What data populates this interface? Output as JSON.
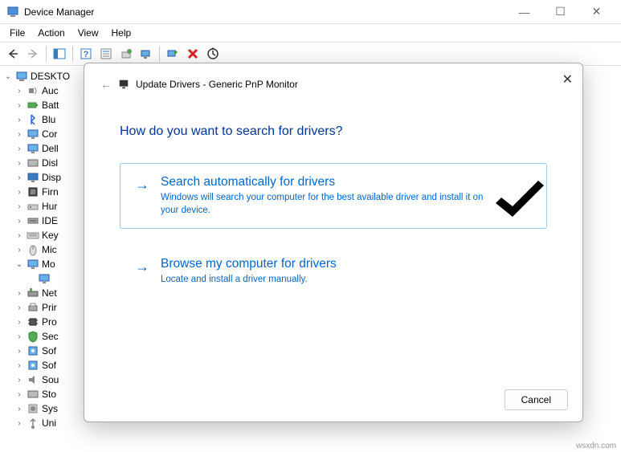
{
  "titlebar": {
    "title": "Device Manager"
  },
  "menu": {
    "file": "File",
    "action": "Action",
    "view": "View",
    "help": "Help"
  },
  "tree": {
    "root": "DESKTO",
    "items": [
      {
        "label": "Auc",
        "icon": "audio"
      },
      {
        "label": "Batt",
        "icon": "battery"
      },
      {
        "label": "Blu",
        "icon": "bluetooth"
      },
      {
        "label": "Cor",
        "icon": "monitor"
      },
      {
        "label": "Dell",
        "icon": "monitor"
      },
      {
        "label": "Disl",
        "icon": "disk"
      },
      {
        "label": "Disp",
        "icon": "display"
      },
      {
        "label": "Firn",
        "icon": "firmware"
      },
      {
        "label": "Hur",
        "icon": "hid"
      },
      {
        "label": "IDE",
        "icon": "ide"
      },
      {
        "label": "Key",
        "icon": "keyboard"
      },
      {
        "label": "Mic",
        "icon": "mouse"
      },
      {
        "label": "Mo",
        "icon": "monitor",
        "expanded": true,
        "children": [
          {
            "label": "",
            "icon": "monitor-item",
            "selected": true
          }
        ]
      },
      {
        "label": "Net",
        "icon": "network"
      },
      {
        "label": "Prir",
        "icon": "printer"
      },
      {
        "label": "Pro",
        "icon": "processor"
      },
      {
        "label": "Sec",
        "icon": "security"
      },
      {
        "label": "Sof",
        "icon": "software"
      },
      {
        "label": "Sof",
        "icon": "software"
      },
      {
        "label": "Sou",
        "icon": "sound"
      },
      {
        "label": "Sto",
        "icon": "storage"
      },
      {
        "label": "Sys",
        "icon": "system"
      },
      {
        "label": "Uni",
        "icon": "usb"
      }
    ]
  },
  "dialog": {
    "title": "Update Drivers - Generic PnP Monitor",
    "heading": "How do you want to search for drivers?",
    "opt1": {
      "title": "Search automatically for drivers",
      "desc": "Windows will search your computer for the best available driver and install it on your device."
    },
    "opt2": {
      "title": "Browse my computer for drivers",
      "desc": "Locate and install a driver manually."
    },
    "cancel": "Cancel"
  },
  "watermark": "wsxdn.com"
}
